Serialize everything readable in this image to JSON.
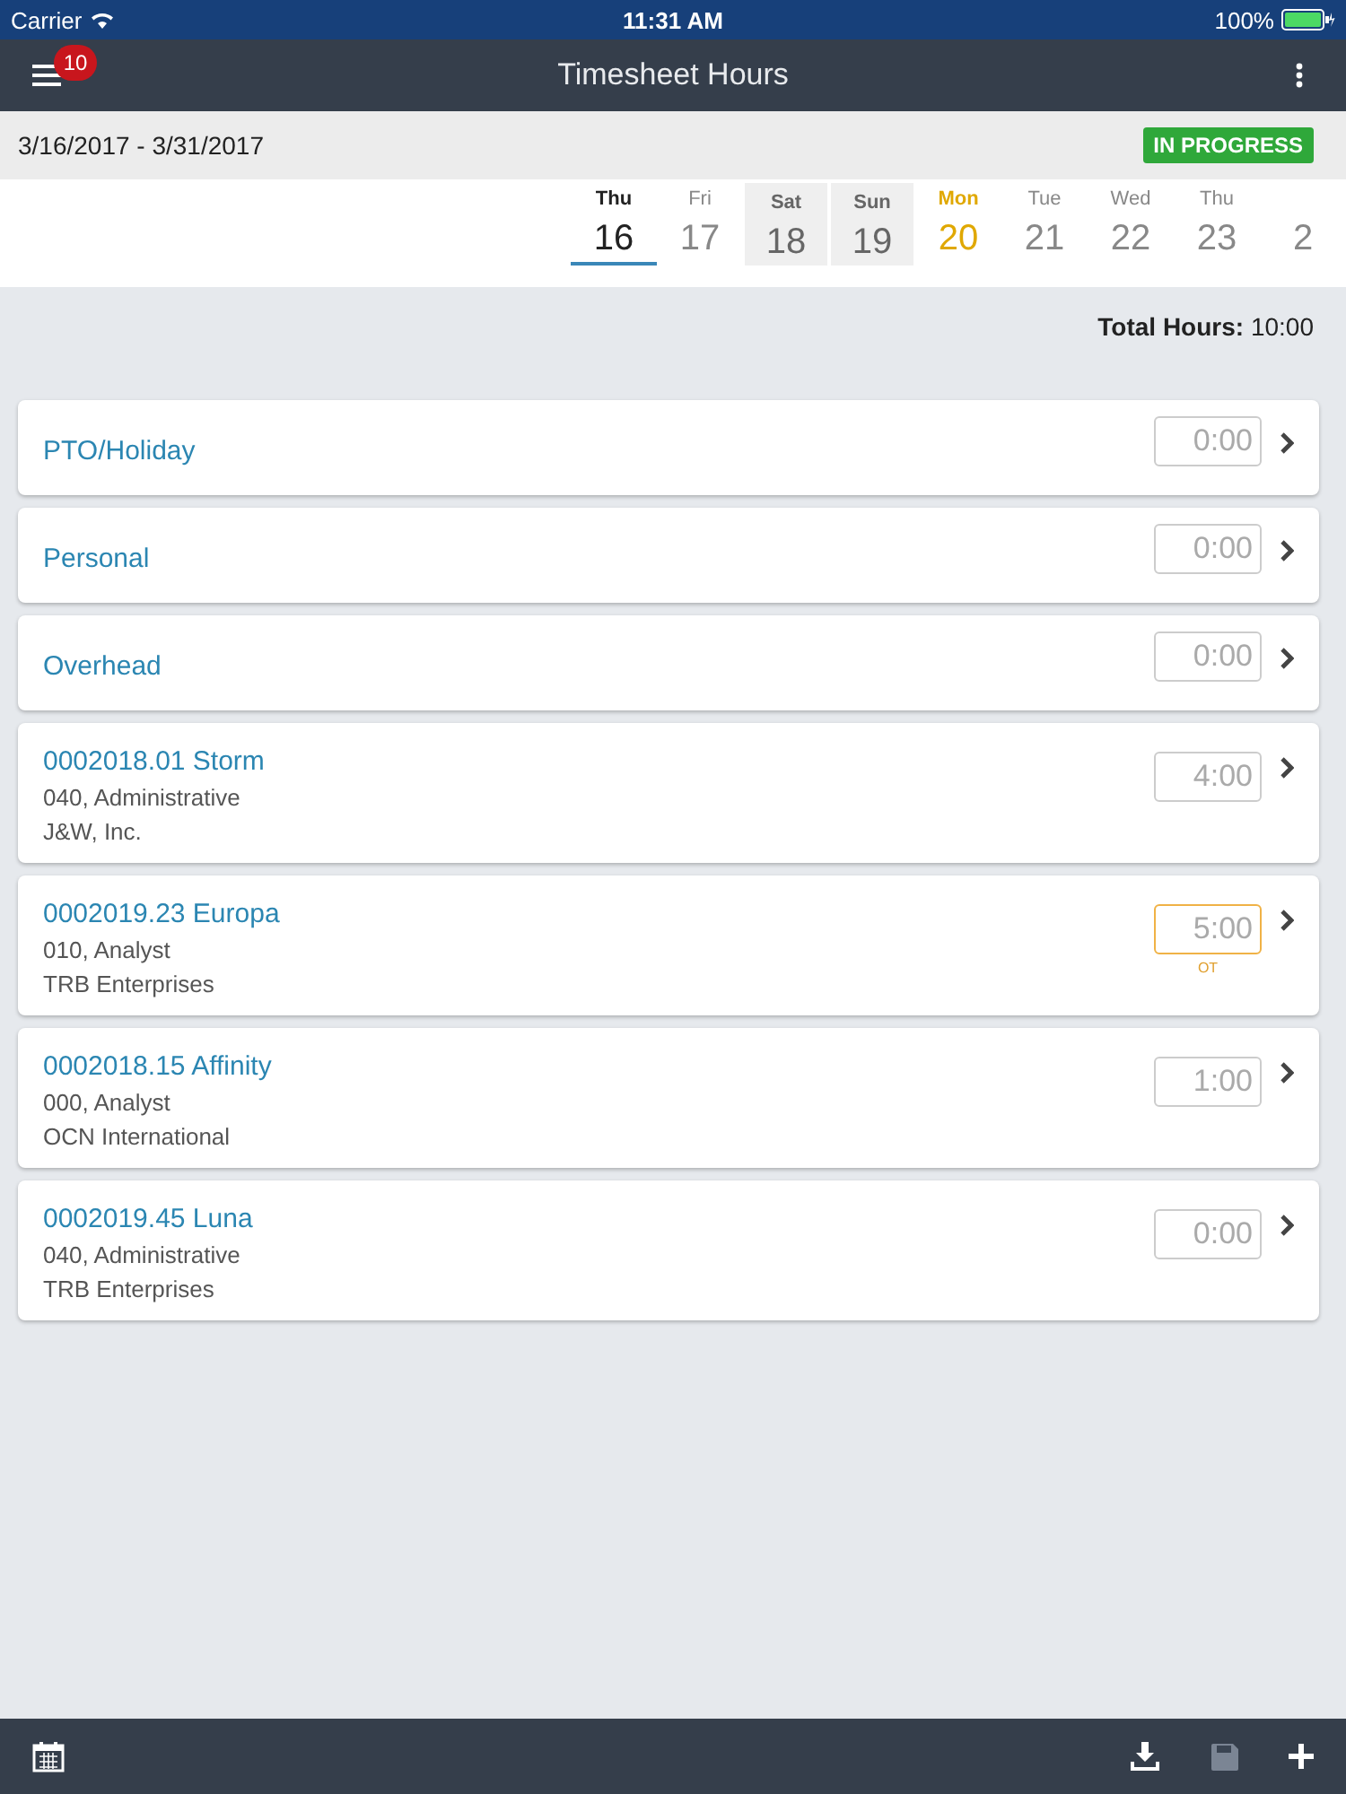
{
  "status_bar": {
    "carrier": "Carrier",
    "time": "11:31 AM",
    "battery": "100%"
  },
  "header": {
    "title": "Timesheet Hours",
    "badge": "10"
  },
  "period": {
    "range": "3/16/2017 - 3/31/2017",
    "status": "IN PROGRESS"
  },
  "days": [
    {
      "weekday": "Thu",
      "number": "16",
      "selected": true,
      "weekend": false,
      "today": false
    },
    {
      "weekday": "Fri",
      "number": "17",
      "selected": false,
      "weekend": false,
      "today": false
    },
    {
      "weekday": "Sat",
      "number": "18",
      "selected": false,
      "weekend": true,
      "today": false
    },
    {
      "weekday": "Sun",
      "number": "19",
      "selected": false,
      "weekend": true,
      "today": false
    },
    {
      "weekday": "Mon",
      "number": "20",
      "selected": false,
      "weekend": false,
      "today": true
    },
    {
      "weekday": "Tue",
      "number": "21",
      "selected": false,
      "weekend": false,
      "today": false
    },
    {
      "weekday": "Wed",
      "number": "22",
      "selected": false,
      "weekend": false,
      "today": false
    },
    {
      "weekday": "Thu",
      "number": "23",
      "selected": false,
      "weekend": false,
      "today": false
    },
    {
      "number": "2",
      "selected": false,
      "weekend": false,
      "today": false
    }
  ],
  "total": {
    "label": "Total Hours:",
    "value": "10:00"
  },
  "entries": [
    {
      "title": "PTO/Holiday",
      "hours": "0:00",
      "overtime": false
    },
    {
      "title": "Personal",
      "hours": "0:00",
      "overtime": false
    },
    {
      "title": "Overhead",
      "hours": "0:00",
      "overtime": false
    },
    {
      "title": "0002018.01 Storm",
      "lines": [
        "040, Administrative",
        "J&W, Inc."
      ],
      "hours": "4:00",
      "overtime": false
    },
    {
      "title": "0002019.23 Europa",
      "lines": [
        "010, Analyst",
        "TRB Enterprises"
      ],
      "hours": "5:00",
      "overtime": true,
      "note": "OT"
    },
    {
      "title": "0002018.15 Affinity",
      "lines": [
        "000, Analyst",
        "OCN International"
      ],
      "hours": "1:00",
      "overtime": false
    },
    {
      "title": "0002019.45 Luna",
      "lines": [
        "040, Administrative",
        "TRB Enterprises"
      ],
      "hours": "0:00",
      "overtime": false
    }
  ]
}
